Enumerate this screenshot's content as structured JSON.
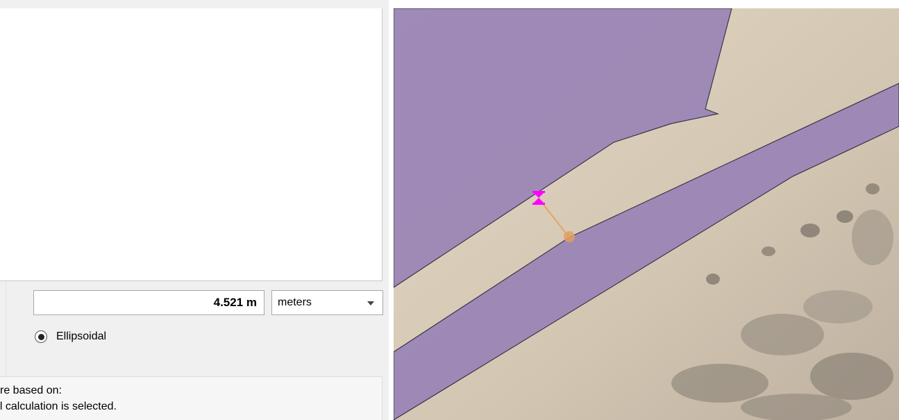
{
  "measure": {
    "total_value": "4.521 m",
    "units_selected": "meters",
    "method_label": "Ellipsoidal",
    "info_line1": "re based on:",
    "info_line2": "al calculation is selected."
  },
  "map": {
    "polygon_fill": "#9a84b6",
    "polygon_stroke": "#3b3347",
    "sand_color": "#ddd0bd",
    "vertex_color": "#ff00ff",
    "measure_line_color": "#e9a263",
    "icons": [
      "vertex-marker-icon",
      "cursor-circle-icon"
    ]
  },
  "colors": {
    "dialog_bg": "#f0f0f0",
    "panel_border": "#a8a8a8"
  }
}
